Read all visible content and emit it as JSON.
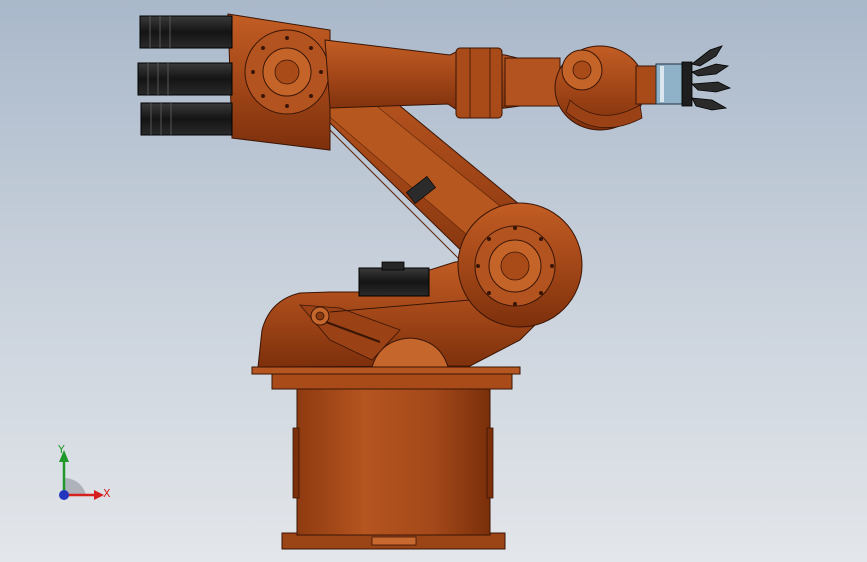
{
  "viewport": {
    "background_top": "#a9b8ca",
    "background_bottom": "#e3e6ea"
  },
  "model": {
    "body_color": "#b2521c",
    "body_dark": "#7a2f0a",
    "motor_color": "#1b1b1b",
    "gripper_band_color": "#8fb2c8"
  },
  "triad": {
    "x_label": "X",
    "y_label": "Y",
    "x_color": "#d62020",
    "y_color": "#1f9a2a",
    "z_color": "#2236c0"
  }
}
